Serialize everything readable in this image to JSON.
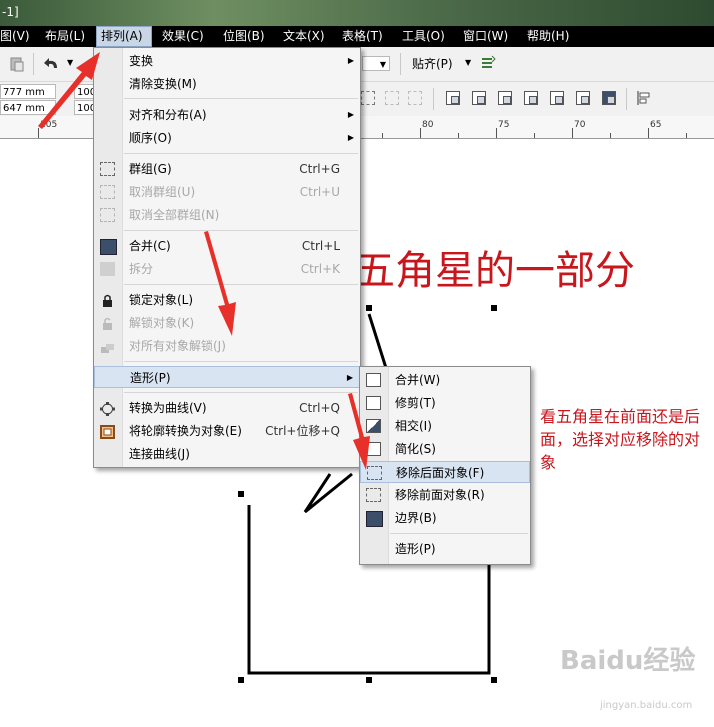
{
  "title_fragment": "-1]",
  "menubar": {
    "items": [
      "图(V)",
      "布局(L)",
      "排列(A)",
      "效果(C)",
      "位图(B)",
      "文本(X)",
      "表格(T)",
      "工具(O)",
      "窗口(W)",
      "帮助(H)"
    ],
    "active_index": 2
  },
  "toolbar": {
    "width_value": "777 mm",
    "height_value": "647 mm",
    "scale1": "100",
    "scale2": "100",
    "snap_label": "贴齐(P)"
  },
  "ruler": {
    "labels": [
      "105",
      "80",
      "75",
      "70",
      "65"
    ]
  },
  "arrange_menu": {
    "items": [
      {
        "label": "变换",
        "shortcut": "",
        "submenu": true,
        "disabled": false
      },
      {
        "label": "清除变换(M)",
        "shortcut": "",
        "submenu": false,
        "disabled": false
      },
      {
        "label": "对齐和分布(A)",
        "shortcut": "",
        "submenu": true,
        "disabled": false
      },
      {
        "label": "顺序(O)",
        "shortcut": "",
        "submenu": true,
        "disabled": false
      },
      {
        "label": "群组(G)",
        "shortcut": "Ctrl+G",
        "submenu": false,
        "disabled": false
      },
      {
        "label": "取消群组(U)",
        "shortcut": "Ctrl+U",
        "submenu": false,
        "disabled": true
      },
      {
        "label": "取消全部群组(N)",
        "shortcut": "",
        "submenu": false,
        "disabled": true
      },
      {
        "label": "合并(C)",
        "shortcut": "Ctrl+L",
        "submenu": false,
        "disabled": false
      },
      {
        "label": "拆分",
        "shortcut": "Ctrl+K",
        "submenu": false,
        "disabled": true
      },
      {
        "label": "锁定对象(L)",
        "shortcut": "",
        "submenu": false,
        "disabled": false
      },
      {
        "label": "解锁对象(K)",
        "shortcut": "",
        "submenu": false,
        "disabled": true
      },
      {
        "label": "对所有对象解锁(J)",
        "shortcut": "",
        "submenu": false,
        "disabled": true
      },
      {
        "label": "造形(P)",
        "shortcut": "",
        "submenu": true,
        "disabled": false,
        "highlighted": true
      },
      {
        "label": "转换为曲线(V)",
        "shortcut": "Ctrl+Q",
        "submenu": false,
        "disabled": false
      },
      {
        "label": "将轮廓转换为对象(E)",
        "shortcut": "Ctrl+位移+Q",
        "submenu": false,
        "disabled": false
      },
      {
        "label": "连接曲线(J)",
        "shortcut": "",
        "submenu": false,
        "disabled": false
      }
    ]
  },
  "shaping_submenu": {
    "items": [
      {
        "label": "合并(W)"
      },
      {
        "label": "修剪(T)"
      },
      {
        "label": "相交(I)"
      },
      {
        "label": "简化(S)"
      },
      {
        "label": "移除后面对象(F)",
        "highlighted": true
      },
      {
        "label": "移除前面对象(R)"
      },
      {
        "label": "边界(B)"
      },
      {
        "label": "造形(P)"
      }
    ]
  },
  "annotations": {
    "heading": "五角星的一部分",
    "note": "看五角星在前面还是后面，选择对应移除的对象",
    "watermark": "Baidu经验",
    "watermark_url": "jingyan.baidu.com"
  },
  "colors": {
    "annotation_red": "#c8161d",
    "arrow_red": "#e8302a",
    "menu_highlight": "#d9e4f2"
  }
}
